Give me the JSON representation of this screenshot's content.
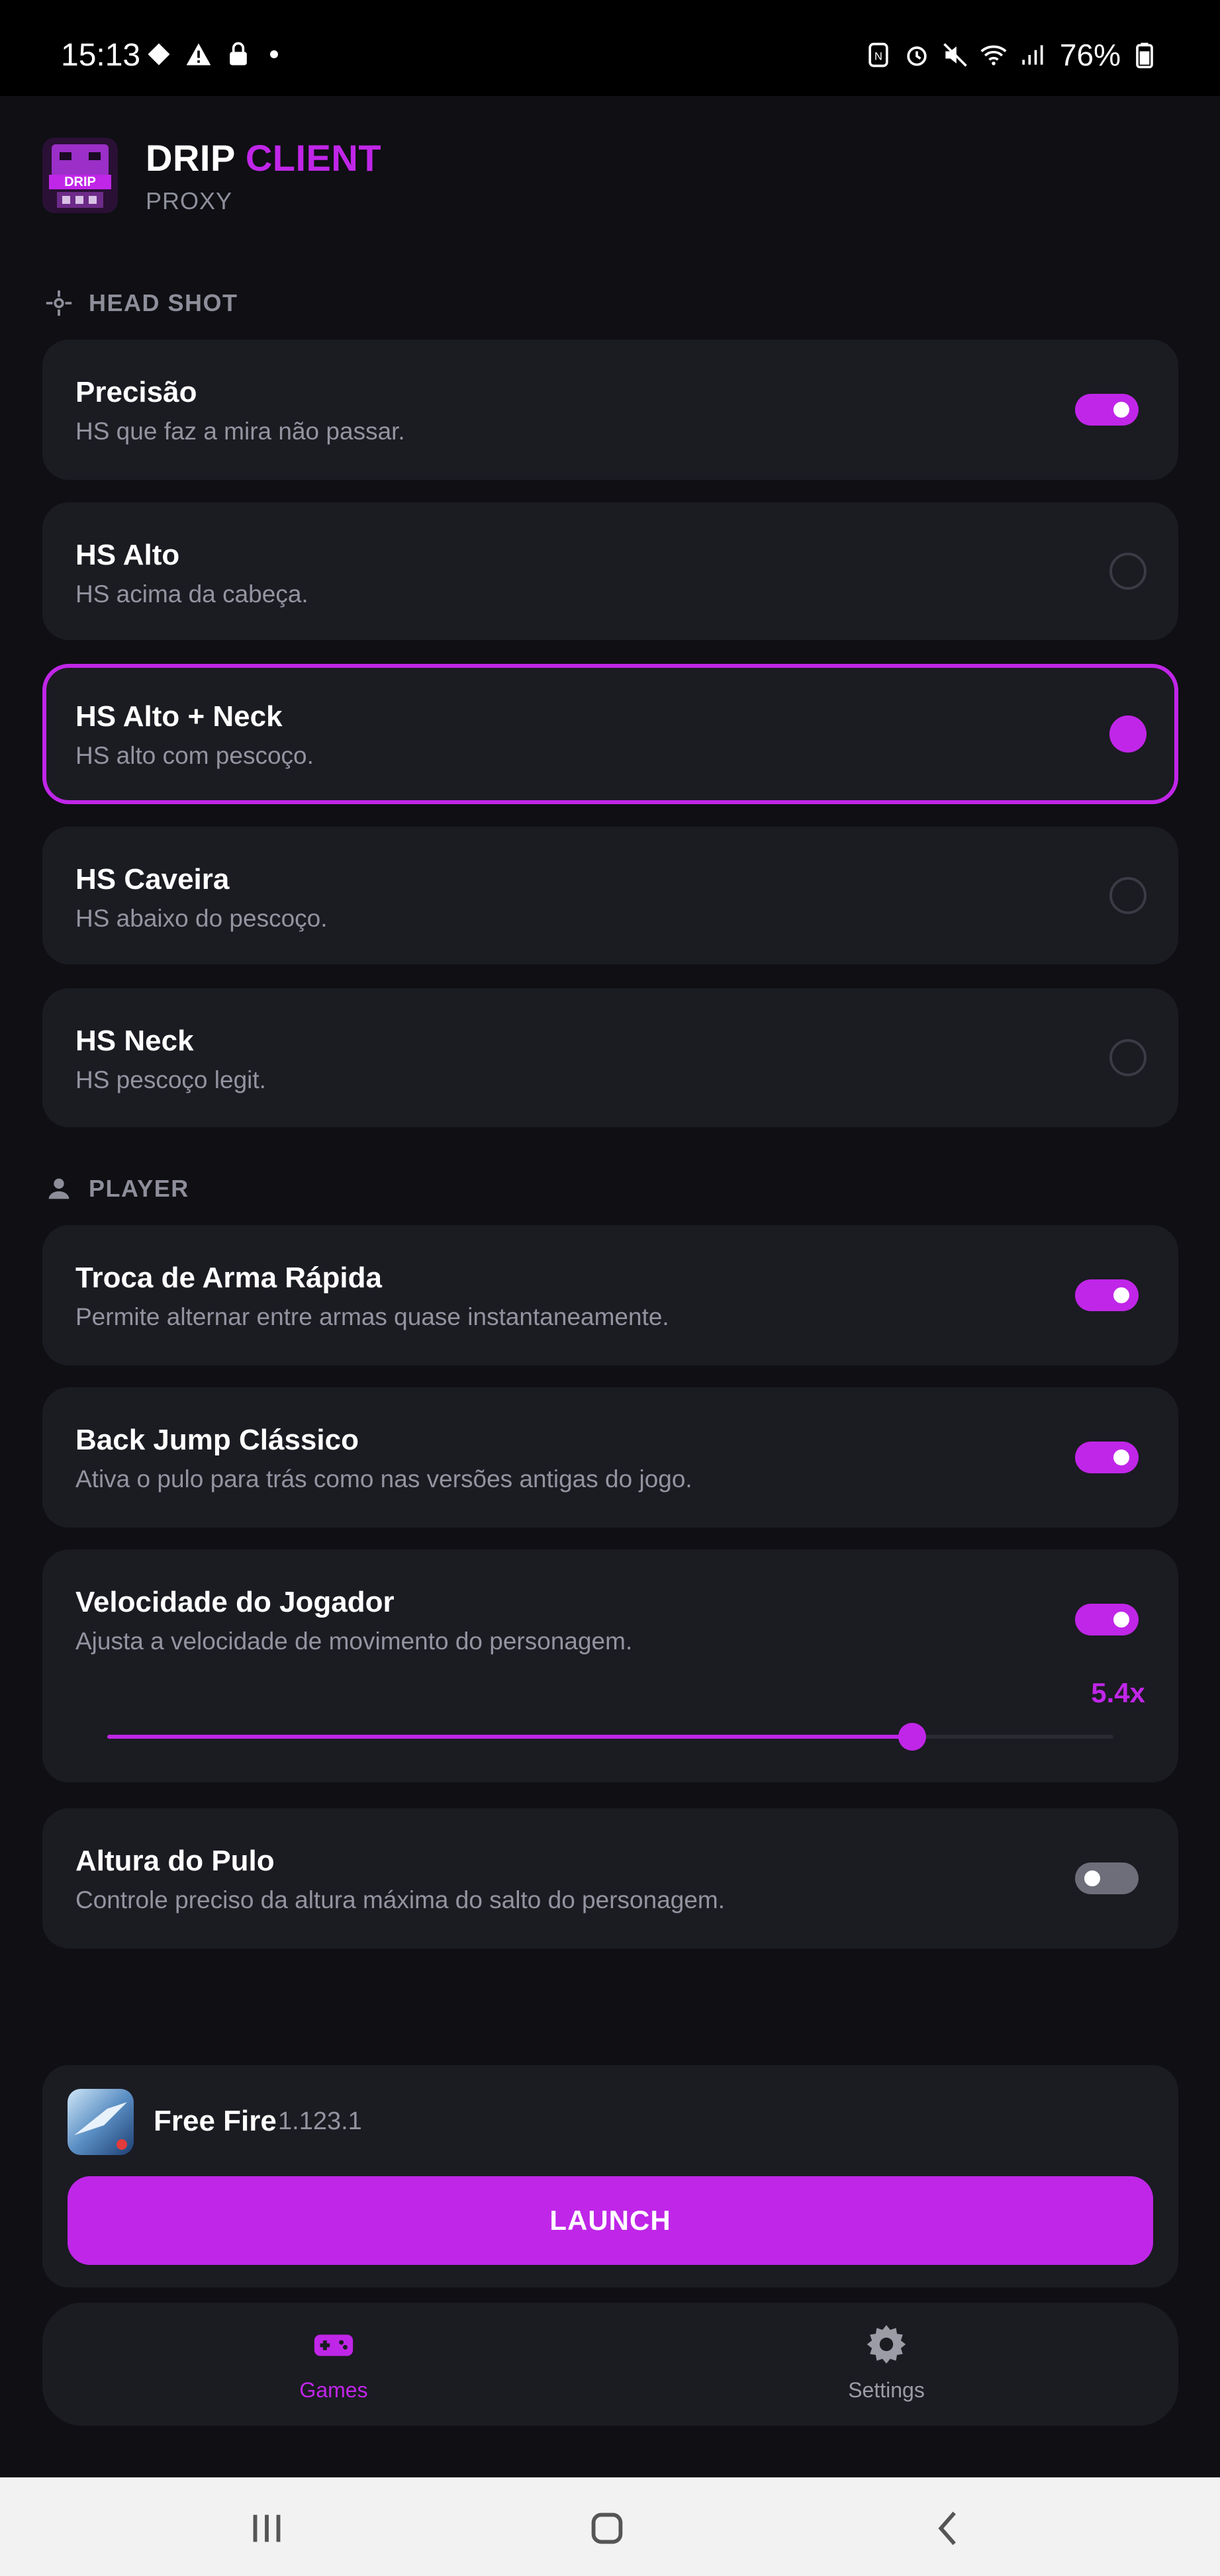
{
  "status_bar": {
    "time": "15:13",
    "battery": "76%",
    "left_icons": [
      "game-icon",
      "warning-icon",
      "lock-icon",
      "dot-icon"
    ],
    "right_icons": [
      "nfc-icon",
      "alarm-icon",
      "mute-icon",
      "wifi-icon",
      "signal-icon",
      "battery-icon"
    ]
  },
  "header": {
    "title_main": "DRIP",
    "title_accent": "CLIENT",
    "subtitle": "PROXY",
    "logo_text": "DRIP"
  },
  "sections": {
    "head_shot": "HEAD SHOT",
    "player": "PLAYER"
  },
  "headshot_items": [
    {
      "title": "Precisão",
      "desc": "HS que faz a mira não passar.",
      "control": "toggle",
      "on": true
    },
    {
      "title": "HS Alto",
      "desc": "HS acima da cabeça.",
      "control": "radio",
      "on": false
    },
    {
      "title": "HS Alto + Neck",
      "desc": "HS alto com pescoço.",
      "control": "radio",
      "on": true
    },
    {
      "title": "HS Caveira",
      "desc": "HS abaixo do pescoço.",
      "control": "radio",
      "on": false
    },
    {
      "title": "HS Neck",
      "desc": "HS pescoço legit.",
      "control": "radio",
      "on": false
    }
  ],
  "player_items": [
    {
      "title": "Troca de Arma Rápida",
      "desc": "Permite alternar entre armas quase instantaneamente.",
      "control": "toggle",
      "on": true
    },
    {
      "title": "Back Jump Clássico",
      "desc": "Ativa o pulo para trás como nas versões antigas do jogo.",
      "control": "toggle",
      "on": true
    },
    {
      "title": "Velocidade do Jogador",
      "desc": "Ajusta a velocidade de movimento do personagem.",
      "control": "toggle",
      "on": true,
      "slider_label": "5.4x",
      "slider_fraction": 0.8
    },
    {
      "title": "Altura do Pulo",
      "desc": "Controle preciso da altura máxima do salto do personagem.",
      "control": "toggle",
      "on": false
    }
  ],
  "game": {
    "name": "Free Fire",
    "version": "1.123.1",
    "launch_label": "LAUNCH"
  },
  "bottom_nav": {
    "games": "Games",
    "settings": "Settings"
  },
  "colors": {
    "accent": "#c026e8",
    "background": "#0f0f14",
    "card": "#1b1b22",
    "muted_text": "#9394a0"
  }
}
